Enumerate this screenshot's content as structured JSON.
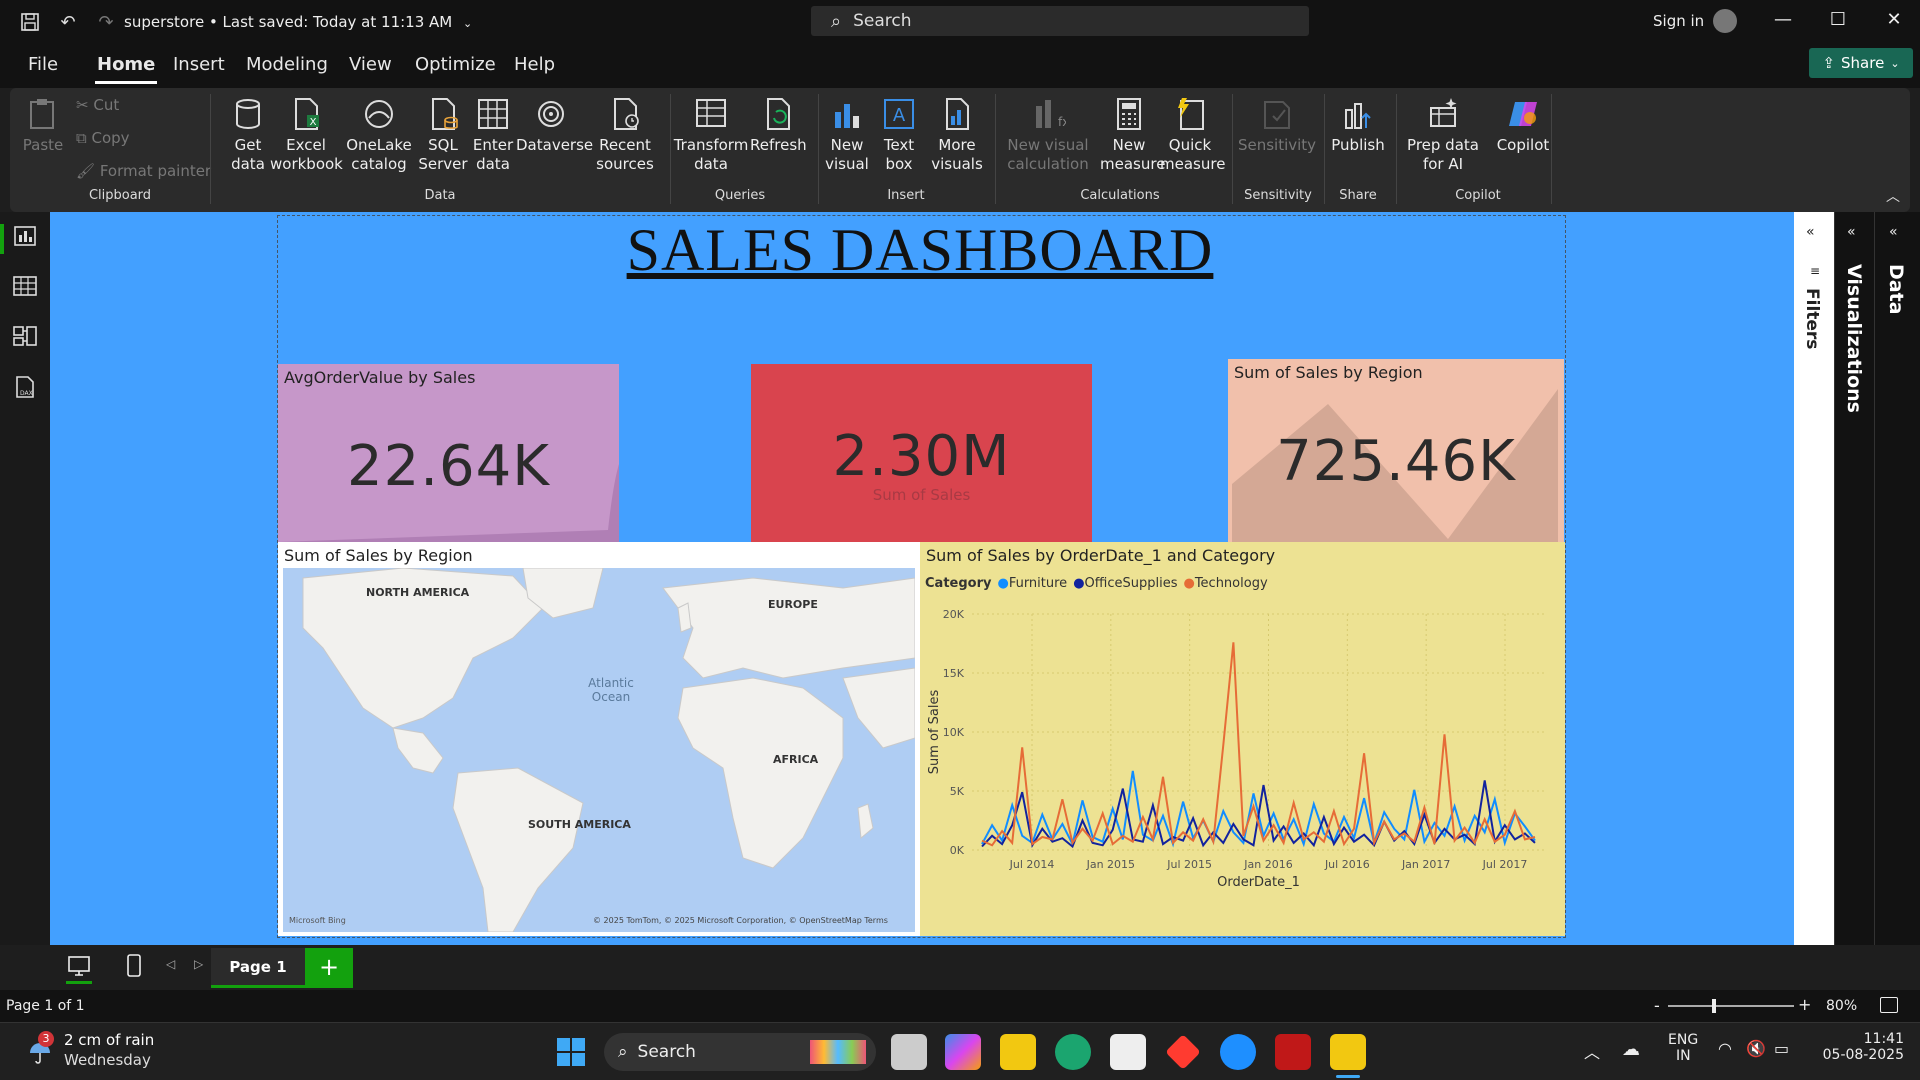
{
  "window": {
    "doc_title": "superstore • Last saved: Today at 11:13 AM",
    "search_placeholder": "Search",
    "sign_in": "Sign in",
    "share": "Share"
  },
  "menu": [
    "File",
    "Home",
    "Insert",
    "Modeling",
    "View",
    "Optimize",
    "Help"
  ],
  "ribbon": {
    "clipboard": {
      "paste": "Paste",
      "cut": "Cut",
      "copy": "Copy",
      "format_painter": "Format painter",
      "label": "Clipboard"
    },
    "data": {
      "get_data": "Get data",
      "excel": "Excel workbook",
      "onelake": "OneLake catalog",
      "sql": "SQL Server",
      "enter": "Enter data",
      "dataverse": "Dataverse",
      "recent": "Recent sources",
      "label": "Data"
    },
    "queries": {
      "transform": "Transform data",
      "refresh": "Refresh",
      "label": "Queries"
    },
    "insert": {
      "new_visual": "New visual",
      "text_box": "Text box",
      "more_visuals": "More visuals",
      "label": "Insert"
    },
    "calculations": {
      "new_visual_calc": "New visual calculation",
      "new_measure": "New measure",
      "quick_measure": "Quick measure",
      "label": "Calculations"
    },
    "sensitivity": {
      "btn": "Sensitivity",
      "label": "Sensitivity"
    },
    "share": {
      "publish": "Publish",
      "label": "Share"
    },
    "copilot": {
      "prep": "Prep data for AI",
      "copilot": "Copilot",
      "label": "Copilot"
    }
  },
  "dashboard": {
    "title": "SALES DASHBOARD",
    "card1": {
      "title": "AvgOrderValue by Sales",
      "value": "22.64K"
    },
    "card2": {
      "value": "2.30M",
      "sub": "Sum of Sales"
    },
    "card3": {
      "title": "Sum of Sales by Region",
      "value": "725.46K"
    },
    "map": {
      "title": "Sum of Sales by Region",
      "labels": [
        "NORTH AMERICA",
        "EUROPE",
        "Atlantic Ocean",
        "AFRICA",
        "SOUTH AMERICA"
      ],
      "attribution": "© 2025 TomTom, © 2025 Microsoft Corporation, © OpenStreetMap  Terms",
      "brand": "Microsoft Bing"
    }
  },
  "chart_data": {
    "type": "line",
    "title": "Sum of Sales by OrderDate_1 and Category",
    "legend_title": "Category",
    "legend_position": "top-left",
    "xlabel": "OrderDate_1",
    "ylabel": "Sum of Sales",
    "x_ticks": [
      "Jul 2014",
      "Jan 2015",
      "Jul 2015",
      "Jan 2016",
      "Jul 2016",
      "Jan 2017",
      "Jul 2017"
    ],
    "y_ticks": [
      "0K",
      "5K",
      "10K",
      "15K",
      "20K"
    ],
    "ylim": [
      0,
      20000
    ],
    "grid": true,
    "series": [
      {
        "name": "Furniture",
        "color": "#118dff",
        "values": [
          500,
          2100,
          800,
          3800,
          1200,
          600,
          3000,
          900,
          2200,
          500,
          4200,
          1100,
          700,
          3500,
          900,
          6700,
          1300,
          800,
          2900,
          500,
          4100,
          1000,
          2500,
          700,
          3300,
          1500,
          600,
          4800,
          1200,
          3100,
          900,
          2600,
          500,
          3900,
          1400,
          700,
          2800,
          1000,
          4400,
          600,
          3200,
          1800,
          900,
          5100,
          700,
          2300,
          1200,
          3700,
          800,
          2900,
          1500,
          4300,
          600,
          3100,
          2000,
          800
        ]
      },
      {
        "name": "OfficeSupplies",
        "color": "#12239e",
        "values": [
          300,
          1200,
          500,
          2100,
          4900,
          400,
          1800,
          700,
          1000,
          300,
          2500,
          600,
          400,
          1700,
          5200,
          900,
          700,
          3800,
          500,
          1100,
          800,
          2700,
          400,
          1500,
          600,
          2200,
          900,
          400,
          5500,
          800,
          2000,
          600,
          1400,
          400,
          2800,
          500,
          1900,
          700,
          1300,
          400,
          2400,
          800,
          1600,
          500,
          3000,
          600,
          1800,
          900,
          1300,
          500,
          5900,
          700,
          2100,
          900,
          1400,
          600
        ]
      },
      {
        "name": "Technology",
        "color": "#e66c37",
        "values": [
          800,
          400,
          1600,
          600,
          8700,
          500,
          1100,
          900,
          4300,
          600,
          1800,
          800,
          3100,
          500,
          1200,
          700,
          2800,
          900,
          6200,
          600,
          1500,
          800,
          2600,
          700,
          8900,
          17600,
          1200,
          3700,
          800,
          2100,
          600,
          4000,
          900,
          1500,
          700,
          3300,
          500,
          1800,
          8200,
          600,
          2400,
          900,
          1400,
          700,
          3600,
          500,
          9800,
          800,
          1900,
          600,
          2600,
          700,
          1300,
          3300,
          900,
          1100
        ]
      }
    ]
  },
  "panes": {
    "filters": "Filters",
    "visualizations": "Visualizations",
    "data": "Data"
  },
  "pages": {
    "tab": "Page 1",
    "status": "Page 1 of 1",
    "zoom": "80%"
  },
  "taskbar": {
    "weather_temp": "2 cm of rain",
    "weather_day": "Wednesday",
    "weather_badge": "3",
    "search": "Search",
    "lang1": "ENG",
    "lang2": "IN",
    "time": "11:41",
    "date": "05-08-2025"
  }
}
